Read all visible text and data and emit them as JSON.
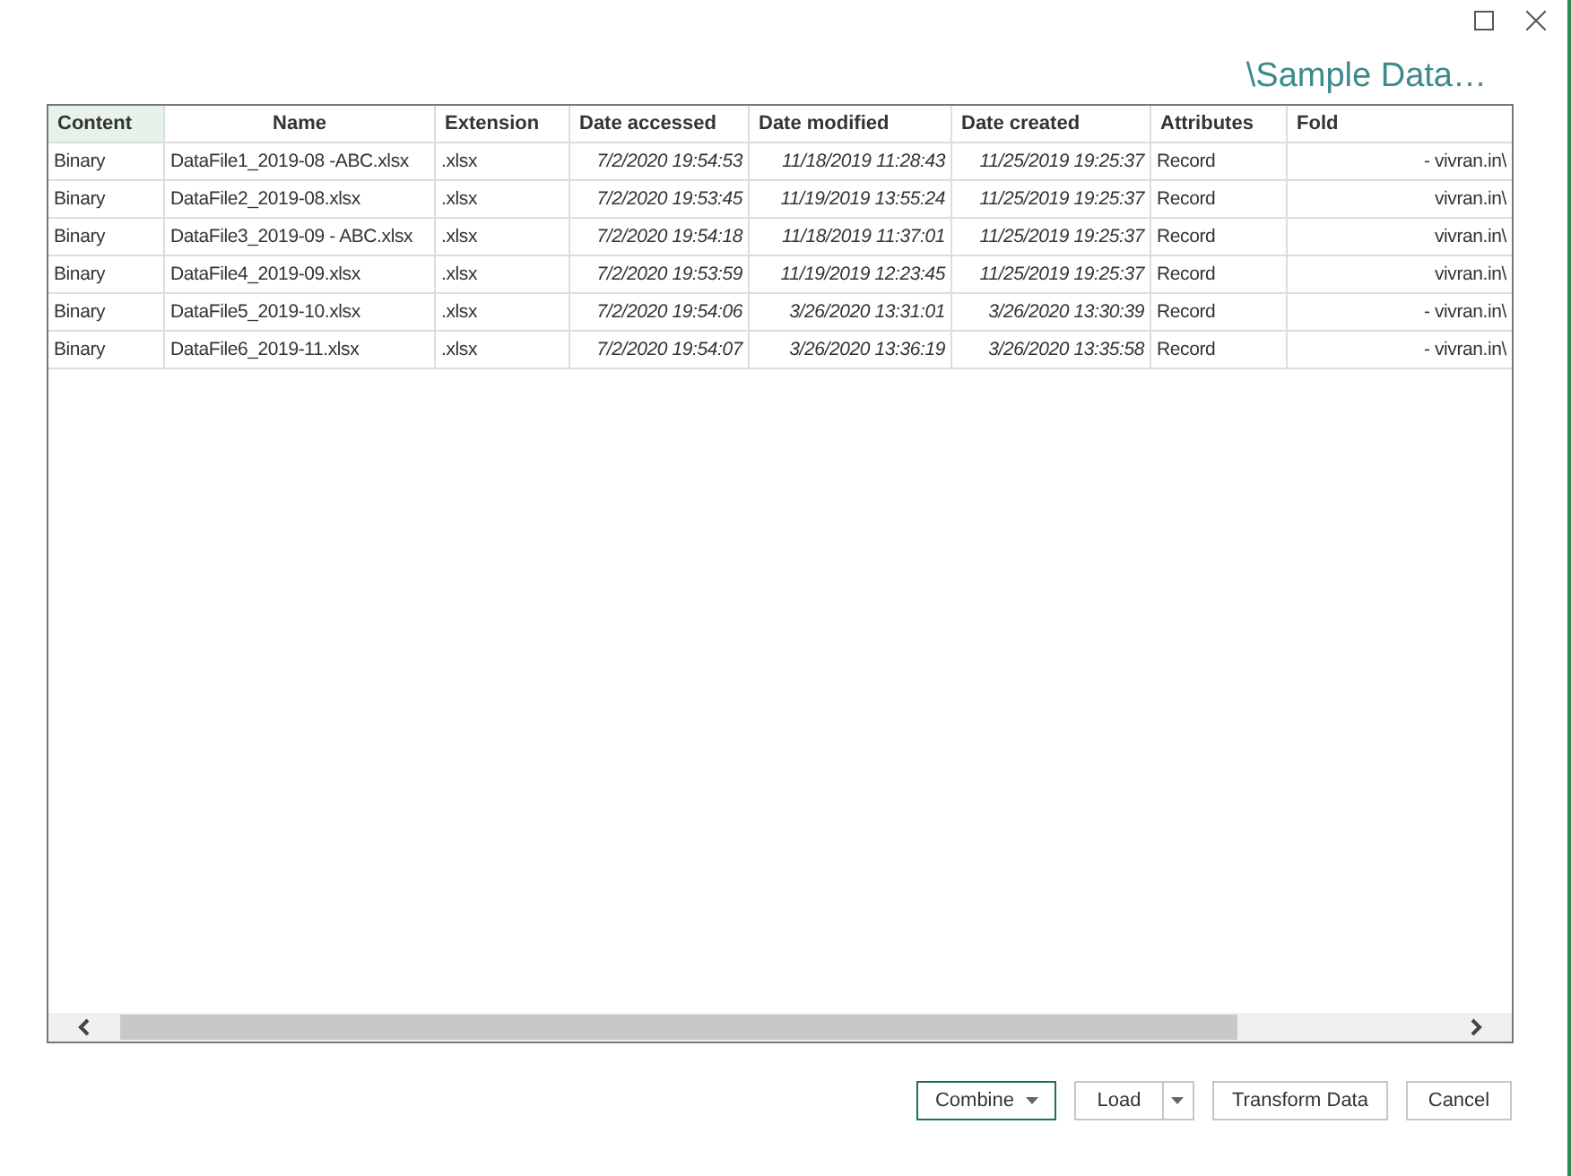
{
  "window": {
    "title": "\\Sample Data…"
  },
  "table": {
    "columns": [
      {
        "label": "Content",
        "selected": true
      },
      {
        "label": "Name",
        "selected": false
      },
      {
        "label": "Extension",
        "selected": false
      },
      {
        "label": "Date accessed",
        "selected": false
      },
      {
        "label": "Date modified",
        "selected": false
      },
      {
        "label": "Date created",
        "selected": false
      },
      {
        "label": "Attributes",
        "selected": false
      },
      {
        "label": "Fold",
        "selected": false
      }
    ],
    "rows": [
      [
        "Binary",
        "DataFile1_2019-08 -ABC.xlsx",
        ".xlsx",
        "7/2/2020 19:54:53",
        "11/18/2019 11:28:43",
        "11/25/2019 19:25:37",
        "Record",
        "- vivran.in\\"
      ],
      [
        "Binary",
        "DataFile2_2019-08.xlsx",
        ".xlsx",
        "7/2/2020 19:53:45",
        "11/19/2019 13:55:24",
        "11/25/2019 19:25:37",
        "Record",
        "vivran.in\\"
      ],
      [
        "Binary",
        "DataFile3_2019-09 - ABC.xlsx",
        ".xlsx",
        "7/2/2020 19:54:18",
        "11/18/2019 11:37:01",
        "11/25/2019 19:25:37",
        "Record",
        "vivran.in\\"
      ],
      [
        "Binary",
        "DataFile4_2019-09.xlsx",
        ".xlsx",
        "7/2/2020 19:53:59",
        "11/19/2019 12:23:45",
        "11/25/2019 19:25:37",
        "Record",
        "vivran.in\\"
      ],
      [
        "Binary",
        "DataFile5_2019-10.xlsx",
        ".xlsx",
        "7/2/2020 19:54:06",
        "3/26/2020 13:31:01",
        "3/26/2020 13:30:39",
        "Record",
        "- vivran.in\\"
      ],
      [
        "Binary",
        "DataFile6_2019-11.xlsx",
        ".xlsx",
        "7/2/2020 19:54:07",
        "3/26/2020 13:36:19",
        "3/26/2020 13:35:58",
        "Record",
        "- vivran.in\\"
      ]
    ]
  },
  "buttons": [
    {
      "label": "Combine",
      "kind": "dropdown",
      "selected": true
    },
    {
      "label": "Load",
      "kind": "split",
      "selected": false
    },
    {
      "label": "Transform Data",
      "kind": "plain",
      "selected": false
    },
    {
      "label": "Cancel",
      "kind": "plain",
      "selected": false
    }
  ]
}
